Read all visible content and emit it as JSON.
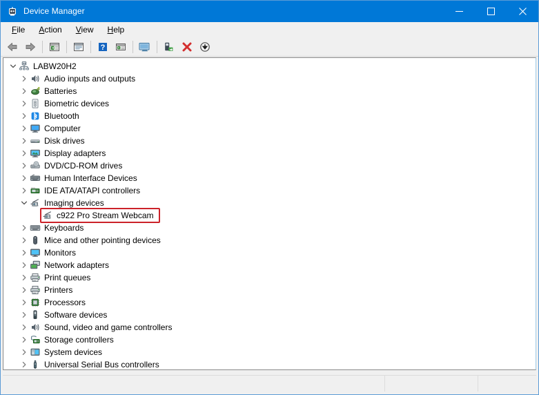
{
  "window": {
    "title": "Device Manager",
    "icon": "device-manager-icon",
    "titlebar_color": "#0078d7",
    "buttons": {
      "minimize": "─",
      "maximize": "□",
      "close": "✕"
    }
  },
  "menubar": {
    "items": [
      {
        "label": "File",
        "accel": "F"
      },
      {
        "label": "Action",
        "accel": "A"
      },
      {
        "label": "View",
        "accel": "V"
      },
      {
        "label": "Help",
        "accel": "H"
      }
    ]
  },
  "toolbar": {
    "items": [
      {
        "name": "back-icon",
        "tooltip": "Back"
      },
      {
        "name": "forward-icon",
        "tooltip": "Forward"
      },
      {
        "name": "separator-1"
      },
      {
        "name": "show-hide-console-tree-icon",
        "tooltip": "Show/Hide Console Tree"
      },
      {
        "name": "separator-2"
      },
      {
        "name": "properties-icon",
        "tooltip": "Properties"
      },
      {
        "name": "separator-3"
      },
      {
        "name": "help-icon",
        "tooltip": "Help"
      },
      {
        "name": "view-icon",
        "tooltip": "View"
      },
      {
        "name": "separator-4"
      },
      {
        "name": "show-hide-action-pane-icon",
        "tooltip": "Show/Hide Action Pane"
      },
      {
        "name": "separator-5"
      },
      {
        "name": "scan-for-hardware-changes-icon",
        "tooltip": "Scan for hardware changes"
      },
      {
        "name": "uninstall-device-icon",
        "tooltip": "Uninstall device"
      },
      {
        "name": "update-driver-icon",
        "tooltip": "Update driver"
      }
    ]
  },
  "tree": {
    "root": {
      "label": "LABW20H2",
      "icon": "computer-root-icon",
      "expanded": true
    },
    "nodes": [
      {
        "label": "Audio inputs and outputs",
        "icon": "speaker-icon",
        "expanded": false,
        "depth": 1
      },
      {
        "label": "Batteries",
        "icon": "battery-icon",
        "expanded": false,
        "depth": 1
      },
      {
        "label": "Biometric devices",
        "icon": "fingerprint-icon",
        "expanded": false,
        "depth": 1
      },
      {
        "label": "Bluetooth",
        "icon": "bluetooth-icon",
        "expanded": false,
        "depth": 1
      },
      {
        "label": "Computer",
        "icon": "monitor-icon",
        "expanded": false,
        "depth": 1
      },
      {
        "label": "Disk drives",
        "icon": "disk-drive-icon",
        "expanded": false,
        "depth": 1
      },
      {
        "label": "Display adapters",
        "icon": "display-adapter-icon",
        "expanded": false,
        "depth": 1
      },
      {
        "label": "DVD/CD-ROM drives",
        "icon": "optical-drive-icon",
        "expanded": false,
        "depth": 1
      },
      {
        "label": "Human Interface Devices",
        "icon": "hid-keyboard-icon",
        "expanded": false,
        "depth": 1
      },
      {
        "label": "IDE ATA/ATAPI controllers",
        "icon": "ide-controller-icon",
        "expanded": false,
        "depth": 1
      },
      {
        "label": "Imaging devices",
        "icon": "camera-icon",
        "expanded": true,
        "depth": 1
      },
      {
        "label": "c922 Pro Stream Webcam",
        "icon": "camera-icon",
        "expanded": null,
        "depth": 2,
        "annotated": true
      },
      {
        "label": "Keyboards",
        "icon": "keyboard-icon",
        "expanded": false,
        "depth": 1
      },
      {
        "label": "Mice and other pointing devices",
        "icon": "mouse-icon",
        "expanded": false,
        "depth": 1
      },
      {
        "label": "Monitors",
        "icon": "monitor-screen-icon",
        "expanded": false,
        "depth": 1
      },
      {
        "label": "Network adapters",
        "icon": "network-adapter-icon",
        "expanded": false,
        "depth": 1
      },
      {
        "label": "Print queues",
        "icon": "printer-icon",
        "expanded": false,
        "depth": 1
      },
      {
        "label": "Printers",
        "icon": "printer-icon",
        "expanded": false,
        "depth": 1
      },
      {
        "label": "Processors",
        "icon": "processor-icon",
        "expanded": false,
        "depth": 1
      },
      {
        "label": "Software devices",
        "icon": "software-device-icon",
        "expanded": false,
        "depth": 1
      },
      {
        "label": "Sound, video and game controllers",
        "icon": "speaker-icon",
        "expanded": false,
        "depth": 1
      },
      {
        "label": "Storage controllers",
        "icon": "storage-controller-icon",
        "expanded": false,
        "depth": 1
      },
      {
        "label": "System devices",
        "icon": "system-device-icon",
        "expanded": false,
        "depth": 1
      },
      {
        "label": "Universal Serial Bus controllers",
        "icon": "usb-icon",
        "expanded": false,
        "depth": 1
      }
    ]
  },
  "annotation": {
    "color": "#cc2229",
    "target_label": "c922 Pro Stream Webcam"
  },
  "statusbar": {
    "panes": [
      "",
      "",
      ""
    ]
  }
}
